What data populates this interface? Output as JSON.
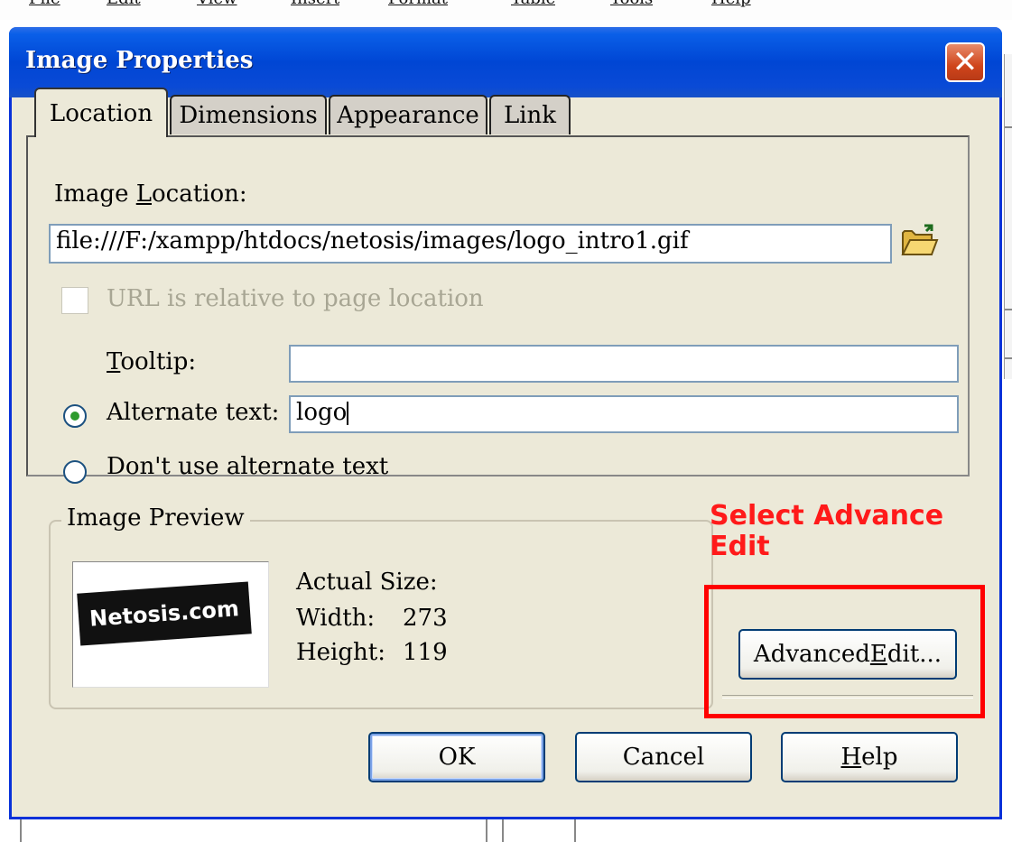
{
  "background": {
    "menu_items": [
      "File",
      "Edit",
      "View",
      "Insert",
      "Format",
      "Table",
      "Tools",
      "Help"
    ]
  },
  "dialog": {
    "title": "Image Properties",
    "close_glyph": "✕",
    "tabs": [
      {
        "label": "Location",
        "active": true
      },
      {
        "label": "Dimensions",
        "active": false
      },
      {
        "label": "Appearance",
        "active": false
      },
      {
        "label": "Link",
        "active": false
      }
    ],
    "location": {
      "image_location_label_pre": "Image ",
      "image_location_label_u": "L",
      "image_location_label_post": "ocation:",
      "image_location_value": "file:///F:/xampp/htdocs/netosis/images/logo_intro1.gif",
      "url_relative_label": "URL is relative to page location",
      "url_relative_checked": false,
      "url_relative_enabled": false,
      "tooltip_label_u": "T",
      "tooltip_label_post": "ooltip:",
      "tooltip_value": "",
      "alternate_text_label": "Alternate text:",
      "alternate_text_selected": true,
      "alternate_text_value": "logo",
      "no_alt_text_label": "Don't use alternate text",
      "no_alt_text_selected": false
    },
    "preview": {
      "group_label": "Image Preview",
      "logo_text": "Netosis.com",
      "actual_size_label": "Actual Size:",
      "width_label": "Width:",
      "width_value": "273",
      "height_label": "Height:",
      "height_value": "119"
    },
    "advanced_edit_pre": "Advanced ",
    "advanced_edit_u": "E",
    "advanced_edit_post": "dit...",
    "buttons": {
      "ok": "OK",
      "cancel": "Cancel",
      "help_u": "H",
      "help_post": "elp"
    }
  },
  "annotation": {
    "text": "Select Advance Edit",
    "color": "#ff0000"
  },
  "colors": {
    "dialog_bg": "#ece9d8",
    "titlebar": "#0046d4",
    "close_button": "#d0451b"
  }
}
